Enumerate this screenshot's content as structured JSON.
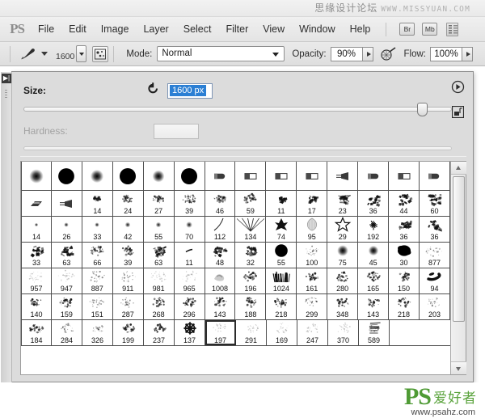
{
  "watermark": {
    "text_cn": "思缘设计论坛",
    "url": "WWW.MISSYUAN.COM"
  },
  "app": {
    "logo": "PS"
  },
  "menubar": {
    "items": [
      {
        "label": "File"
      },
      {
        "label": "Edit"
      },
      {
        "label": "Image"
      },
      {
        "label": "Layer"
      },
      {
        "label": "Select"
      },
      {
        "label": "Filter"
      },
      {
        "label": "View"
      },
      {
        "label": "Window"
      },
      {
        "label": "Help"
      }
    ],
    "bridge_button": "Br",
    "mini_bridge_button": "Mb"
  },
  "options_bar": {
    "brush_size_value": "1600",
    "mode_label": "Mode:",
    "mode_value": "Normal",
    "opacity_label": "Opacity:",
    "opacity_value": "90%",
    "flow_label": "Flow:",
    "flow_value": "100%"
  },
  "brush_picker": {
    "size_label": "Size:",
    "size_value": "1600 px",
    "hardness_label": "Hardness:",
    "hardness_value": "",
    "grid": {
      "selected_label": "197",
      "rows": [
        [
          {
            "label": "",
            "kind": "soft-round",
            "size": 14
          },
          {
            "label": "",
            "kind": "hard-round",
            "size": 19
          },
          {
            "label": "",
            "kind": "soft-round",
            "size": 13
          },
          {
            "label": "",
            "kind": "hard-round",
            "size": 20
          },
          {
            "label": "",
            "kind": "soft-round",
            "size": 12
          },
          {
            "label": "",
            "kind": "hard-round",
            "size": 21
          },
          {
            "label": "",
            "kind": "flat-tip",
            "size": 12
          },
          {
            "label": "",
            "kind": "flat-block",
            "size": 14
          },
          {
            "label": "",
            "kind": "flat-block",
            "size": 13
          },
          {
            "label": "",
            "kind": "flat-block",
            "size": 14
          },
          {
            "label": "",
            "kind": "cone",
            "size": 14
          },
          {
            "label": "",
            "kind": "flat-tip",
            "size": 14
          },
          {
            "label": "",
            "kind": "flat-block",
            "size": 14
          },
          {
            "label": "",
            "kind": "flat-tip",
            "size": 14
          }
        ],
        [
          {
            "label": "",
            "kind": "flat-angle",
            "size": 14
          },
          {
            "label": "",
            "kind": "cone",
            "size": 15
          },
          {
            "label": "14",
            "kind": "spatter",
            "size": 9
          },
          {
            "label": "24",
            "kind": "spatter",
            "size": 12
          },
          {
            "label": "27",
            "kind": "spatter",
            "size": 13
          },
          {
            "label": "39",
            "kind": "spatter",
            "size": 14
          },
          {
            "label": "46",
            "kind": "spatter",
            "size": 14
          },
          {
            "label": "59",
            "kind": "spatter",
            "size": 15
          },
          {
            "label": "11",
            "kind": "chalk",
            "size": 7
          },
          {
            "label": "17",
            "kind": "chalk",
            "size": 11
          },
          {
            "label": "23",
            "kind": "chalk",
            "size": 12
          },
          {
            "label": "36",
            "kind": "chalk",
            "size": 14
          },
          {
            "label": "44",
            "kind": "chalk",
            "size": 14
          },
          {
            "label": "60",
            "kind": "chalk",
            "size": 15
          }
        ],
        [
          {
            "label": "14",
            "kind": "soft-dot",
            "size": 4
          },
          {
            "label": "26",
            "kind": "soft-dot",
            "size": 5
          },
          {
            "label": "33",
            "kind": "soft-dot",
            "size": 5
          },
          {
            "label": "42",
            "kind": "soft-dot",
            "size": 6
          },
          {
            "label": "55",
            "kind": "soft-dot",
            "size": 6
          },
          {
            "label": "70",
            "kind": "soft-dot",
            "size": 7
          },
          {
            "label": "112",
            "kind": "curve",
            "size": 16
          },
          {
            "label": "134",
            "kind": "grass",
            "size": 16
          },
          {
            "label": "74",
            "kind": "leaf",
            "size": 14
          },
          {
            "label": "95",
            "kind": "shell",
            "size": 14
          },
          {
            "label": "29",
            "kind": "star",
            "size": 15
          },
          {
            "label": "192",
            "kind": "starburst",
            "size": 10
          },
          {
            "label": "36",
            "kind": "chalk",
            "size": 14
          },
          {
            "label": "36",
            "kind": "chalk",
            "size": 14
          }
        ],
        [
          {
            "label": "33",
            "kind": "chalk",
            "size": 14
          },
          {
            "label": "63",
            "kind": "chalk",
            "size": 14
          },
          {
            "label": "66",
            "kind": "spatter",
            "size": 15
          },
          {
            "label": "39",
            "kind": "spatter",
            "size": 14
          },
          {
            "label": "63",
            "kind": "chalk",
            "size": 14
          },
          {
            "label": "11",
            "kind": "dash",
            "size": 8
          },
          {
            "label": "48",
            "kind": "chalk",
            "size": 14
          },
          {
            "label": "32",
            "kind": "chalk",
            "size": 13
          },
          {
            "label": "55",
            "kind": "hard-round",
            "size": 15
          },
          {
            "label": "100",
            "kind": "spatter-light",
            "size": 16
          },
          {
            "label": "75",
            "kind": "soft-round",
            "size": 11
          },
          {
            "label": "45",
            "kind": "soft-round",
            "size": 10
          },
          {
            "label": "30",
            "kind": "blob",
            "size": 16
          },
          {
            "label": "877",
            "kind": "spray-light",
            "size": 18
          }
        ],
        [
          {
            "label": "957",
            "kind": "spray-faint",
            "size": 18
          },
          {
            "label": "947",
            "kind": "spray-faint",
            "size": 18
          },
          {
            "label": "887",
            "kind": "spray-light",
            "size": 18
          },
          {
            "label": "911",
            "kind": "spray-light",
            "size": 18
          },
          {
            "label": "981",
            "kind": "spray-faint",
            "size": 18
          },
          {
            "label": "965",
            "kind": "spray-faint",
            "size": 18
          },
          {
            "label": "1008",
            "kind": "smudge",
            "size": 16
          },
          {
            "label": "196",
            "kind": "spray",
            "size": 16
          },
          {
            "label": "1024",
            "kind": "grass-dense",
            "size": 15
          },
          {
            "label": "161",
            "kind": "spray",
            "size": 16
          },
          {
            "label": "280",
            "kind": "spray",
            "size": 16
          },
          {
            "label": "165",
            "kind": "spray",
            "size": 16
          },
          {
            "label": "150",
            "kind": "spray",
            "size": 16
          },
          {
            "label": "94",
            "kind": "stroke-blob",
            "size": 16
          }
        ],
        [
          {
            "label": "140",
            "kind": "spray",
            "size": 16
          },
          {
            "label": "159",
            "kind": "spray",
            "size": 16
          },
          {
            "label": "151",
            "kind": "spray-light",
            "size": 16
          },
          {
            "label": "287",
            "kind": "spray-light",
            "size": 16
          },
          {
            "label": "268",
            "kind": "spray",
            "size": 16
          },
          {
            "label": "296",
            "kind": "spray",
            "size": 16
          },
          {
            "label": "143",
            "kind": "spray",
            "size": 16
          },
          {
            "label": "188",
            "kind": "spray",
            "size": 16
          },
          {
            "label": "218",
            "kind": "spray",
            "size": 16
          },
          {
            "label": "299",
            "kind": "spray-light",
            "size": 16
          },
          {
            "label": "348",
            "kind": "spray",
            "size": 16
          },
          {
            "label": "143",
            "kind": "spray",
            "size": 16
          },
          {
            "label": "218",
            "kind": "spray",
            "size": 16
          },
          {
            "label": "203",
            "kind": "spray-light",
            "size": 16
          }
        ],
        [
          {
            "label": "184",
            "kind": "spray",
            "size": 16
          },
          {
            "label": "284",
            "kind": "spray-light",
            "size": 16
          },
          {
            "label": "326",
            "kind": "spray-light",
            "size": 16
          },
          {
            "label": "199",
            "kind": "spray",
            "size": 16
          },
          {
            "label": "237",
            "kind": "spray",
            "size": 16
          },
          {
            "label": "137",
            "kind": "snowflake",
            "size": 14
          },
          {
            "label": "197",
            "kind": "spray-faint",
            "size": 16
          },
          {
            "label": "291",
            "kind": "spray-faint",
            "size": 16
          },
          {
            "label": "169",
            "kind": "spray-faint",
            "size": 16
          },
          {
            "label": "247",
            "kind": "spray-faint",
            "size": 16
          },
          {
            "label": "370",
            "kind": "spray-faint",
            "size": 16
          },
          {
            "label": "589",
            "kind": "scratch",
            "size": 16
          }
        ]
      ]
    }
  },
  "site_logo": {
    "ps": "PS",
    "cn": "爱好者",
    "url": "www.psahz.com",
    "color": "#4f9b35"
  }
}
